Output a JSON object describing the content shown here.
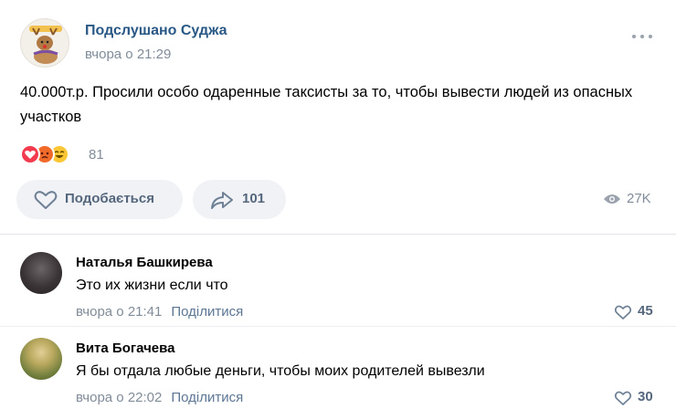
{
  "post": {
    "group_name": "Подслушано Суджа",
    "time": "вчора о 21:29",
    "text": "40.000т.р. Просили особо одаренные таксисты за то, чтобы вывести людей из опасных участков",
    "reactions": {
      "icons": [
        "heart-reaction",
        "angry-reaction",
        "laughing-reaction"
      ],
      "count": "81"
    },
    "like_label": "Подобається",
    "share_count": "101",
    "views": "27K"
  },
  "comments": [
    {
      "author": "Наталья Башкирева",
      "text": "Это их жизни если что",
      "time": "вчора о 21:41",
      "share_label": "Поділитися",
      "likes": "45"
    },
    {
      "author": "Вита Богачева",
      "text": "Я бы отдала любые деньги, чтобы моих родителей вывезли",
      "time": "вчора о 22:02",
      "share_label": "Поділитися",
      "likes": "30"
    }
  ],
  "colors": {
    "link": "#2a5885",
    "secondary": "#818c99",
    "button_bg": "#f0f2f5",
    "button_text": "#55677d"
  }
}
